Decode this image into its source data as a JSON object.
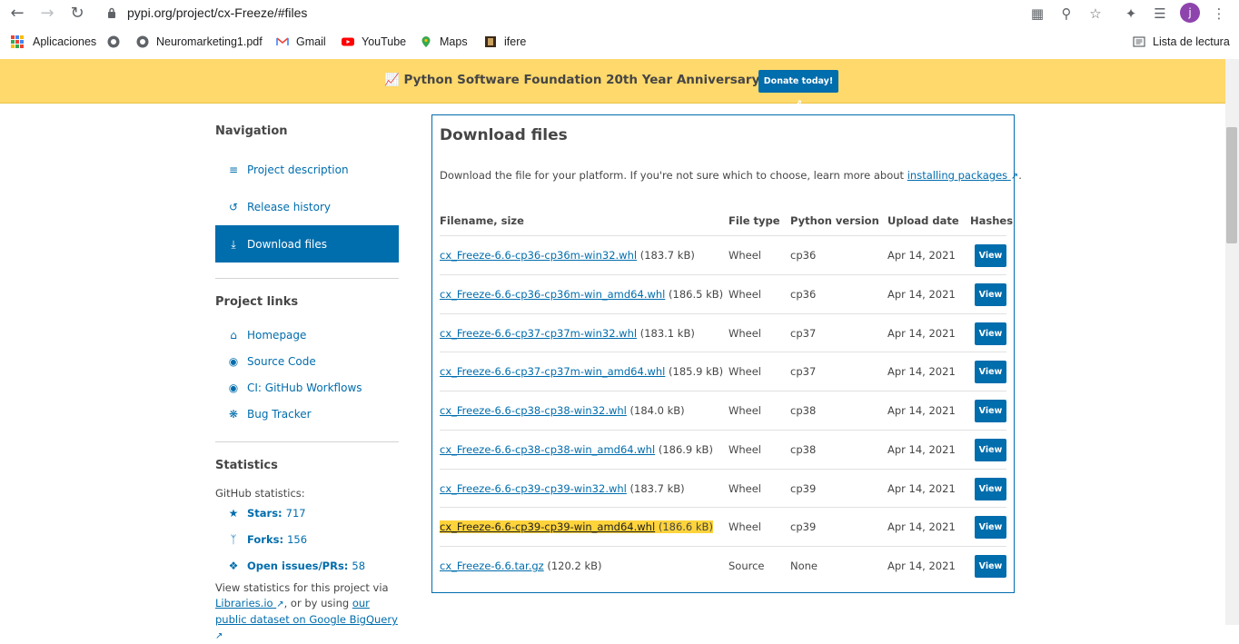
{
  "browser": {
    "url": "pypi.org/project/cx-Freeze/#files",
    "avatar_letter": "j"
  },
  "bookmarks": [
    {
      "label": "Aplicaciones",
      "icon": "apps-grid-icon"
    },
    {
      "label": "",
      "icon": "globe-icon"
    },
    {
      "label": "Neuromarketing1.pdf",
      "icon": "globe-icon"
    },
    {
      "label": "Gmail",
      "icon": "gmail-icon"
    },
    {
      "label": "YouTube",
      "icon": "youtube-icon"
    },
    {
      "label": "Maps",
      "icon": "maps-icon"
    },
    {
      "label": "ifere",
      "icon": "ifere-icon"
    }
  ],
  "reading_list": "Lista de lectura",
  "banner": {
    "text": "Python Software Foundation 20th Year Anniversary Fundraiser",
    "button": "Donate today!"
  },
  "sidebar": {
    "navigation_title": "Navigation",
    "nav_items": [
      {
        "label": "Project description",
        "icon": "align-left-icon"
      },
      {
        "label": "Release history",
        "icon": "history-icon"
      },
      {
        "label": "Download files",
        "icon": "download-icon",
        "active": true
      }
    ],
    "project_links_title": "Project links",
    "links": [
      {
        "label": "Homepage",
        "icon": "home-icon"
      },
      {
        "label": "Source Code",
        "icon": "github-icon"
      },
      {
        "label": "CI: GitHub Workflows",
        "icon": "github-icon"
      },
      {
        "label": "Bug Tracker",
        "icon": "bug-icon"
      }
    ],
    "statistics_title": "Statistics",
    "github_stats_label": "GitHub statistics:",
    "stats": [
      {
        "label": "Stars:",
        "value": "717",
        "icon": "star-icon"
      },
      {
        "label": "Forks:",
        "value": "156",
        "icon": "fork-icon"
      },
      {
        "label": "Open issues/PRs:",
        "value": "58",
        "icon": "info-icon"
      }
    ],
    "blurb_prefix": "View statistics for this project via",
    "blurb_link1": "Libraries.io",
    "blurb_mid": ", or by using",
    "blurb_link2": "our public dataset on Google BigQuery"
  },
  "main": {
    "title": "Download files",
    "intro_prefix": "Download the file for your platform. If you're not sure which to choose, learn more about",
    "intro_link": "installing packages",
    "intro_suffix": ".",
    "columns": [
      "Filename, size",
      "File type",
      "Python version",
      "Upload date",
      "Hashes"
    ],
    "rows": [
      {
        "file": "cx_Freeze-6.6-cp36-cp36m-win32.whl",
        "size": "(183.7 kB)",
        "type": "Wheel",
        "python": "cp36",
        "date": "Apr 14, 2021",
        "button": "View"
      },
      {
        "file": "cx_Freeze-6.6-cp36-cp36m-win_amd64.whl",
        "size": "(186.5 kB)",
        "type": "Wheel",
        "python": "cp36",
        "date": "Apr 14, 2021",
        "button": "View"
      },
      {
        "file": "cx_Freeze-6.6-cp37-cp37m-win32.whl",
        "size": "(183.1 kB)",
        "type": "Wheel",
        "python": "cp37",
        "date": "Apr 14, 2021",
        "button": "View"
      },
      {
        "file": "cx_Freeze-6.6-cp37-cp37m-win_amd64.whl",
        "size": "(185.9 kB)",
        "type": "Wheel",
        "python": "cp37",
        "date": "Apr 14, 2021",
        "button": "View"
      },
      {
        "file": "cx_Freeze-6.6-cp38-cp38-win32.whl",
        "size": "(184.0 kB)",
        "type": "Wheel",
        "python": "cp38",
        "date": "Apr 14, 2021",
        "button": "View"
      },
      {
        "file": "cx_Freeze-6.6-cp38-cp38-win_amd64.whl",
        "size": "(186.9 kB)",
        "type": "Wheel",
        "python": "cp38",
        "date": "Apr 14, 2021",
        "button": "View"
      },
      {
        "file": "cx_Freeze-6.6-cp39-cp39-win32.whl",
        "size": "(183.7 kB)",
        "type": "Wheel",
        "python": "cp39",
        "date": "Apr 14, 2021",
        "button": "View"
      },
      {
        "file": "cx_Freeze-6.6-cp39-cp39-win_amd64.whl",
        "size": "(186.6 kB)",
        "type": "Wheel",
        "python": "cp39",
        "date": "Apr 14, 2021",
        "button": "View",
        "highlighted": true
      },
      {
        "file": "cx_Freeze-6.6.tar.gz",
        "size": "(120.2 kB)",
        "type": "Source",
        "python": "None",
        "date": "Apr 14, 2021",
        "button": "View"
      }
    ]
  },
  "colors": {
    "pypi_blue": "#006dad",
    "banner_yellow": "#ffd96b",
    "highlight_yellow": "#ffd43b"
  }
}
